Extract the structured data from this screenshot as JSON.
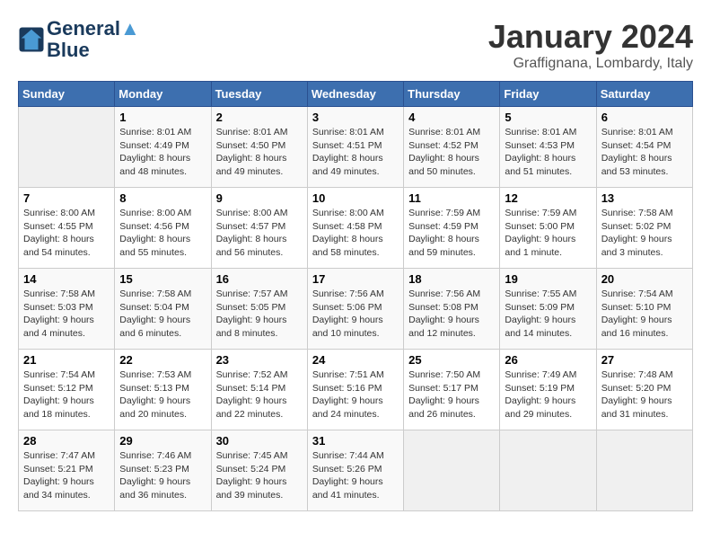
{
  "header": {
    "logo_line1": "General",
    "logo_line2": "Blue",
    "month": "January 2024",
    "location": "Graffignana, Lombardy, Italy"
  },
  "weekdays": [
    "Sunday",
    "Monday",
    "Tuesday",
    "Wednesday",
    "Thursday",
    "Friday",
    "Saturday"
  ],
  "weeks": [
    [
      {
        "day": "",
        "empty": true
      },
      {
        "day": "1",
        "sunrise": "8:01 AM",
        "sunset": "4:49 PM",
        "daylight": "8 hours and 48 minutes."
      },
      {
        "day": "2",
        "sunrise": "8:01 AM",
        "sunset": "4:50 PM",
        "daylight": "8 hours and 49 minutes."
      },
      {
        "day": "3",
        "sunrise": "8:01 AM",
        "sunset": "4:51 PM",
        "daylight": "8 hours and 49 minutes."
      },
      {
        "day": "4",
        "sunrise": "8:01 AM",
        "sunset": "4:52 PM",
        "daylight": "8 hours and 50 minutes."
      },
      {
        "day": "5",
        "sunrise": "8:01 AM",
        "sunset": "4:53 PM",
        "daylight": "8 hours and 51 minutes."
      },
      {
        "day": "6",
        "sunrise": "8:01 AM",
        "sunset": "4:54 PM",
        "daylight": "8 hours and 53 minutes."
      }
    ],
    [
      {
        "day": "7",
        "sunrise": "8:00 AM",
        "sunset": "4:55 PM",
        "daylight": "8 hours and 54 minutes."
      },
      {
        "day": "8",
        "sunrise": "8:00 AM",
        "sunset": "4:56 PM",
        "daylight": "8 hours and 55 minutes."
      },
      {
        "day": "9",
        "sunrise": "8:00 AM",
        "sunset": "4:57 PM",
        "daylight": "8 hours and 56 minutes."
      },
      {
        "day": "10",
        "sunrise": "8:00 AM",
        "sunset": "4:58 PM",
        "daylight": "8 hours and 58 minutes."
      },
      {
        "day": "11",
        "sunrise": "7:59 AM",
        "sunset": "4:59 PM",
        "daylight": "8 hours and 59 minutes."
      },
      {
        "day": "12",
        "sunrise": "7:59 AM",
        "sunset": "5:00 PM",
        "daylight": "9 hours and 1 minute."
      },
      {
        "day": "13",
        "sunrise": "7:58 AM",
        "sunset": "5:02 PM",
        "daylight": "9 hours and 3 minutes."
      }
    ],
    [
      {
        "day": "14",
        "sunrise": "7:58 AM",
        "sunset": "5:03 PM",
        "daylight": "9 hours and 4 minutes."
      },
      {
        "day": "15",
        "sunrise": "7:58 AM",
        "sunset": "5:04 PM",
        "daylight": "9 hours and 6 minutes."
      },
      {
        "day": "16",
        "sunrise": "7:57 AM",
        "sunset": "5:05 PM",
        "daylight": "9 hours and 8 minutes."
      },
      {
        "day": "17",
        "sunrise": "7:56 AM",
        "sunset": "5:06 PM",
        "daylight": "9 hours and 10 minutes."
      },
      {
        "day": "18",
        "sunrise": "7:56 AM",
        "sunset": "5:08 PM",
        "daylight": "9 hours and 12 minutes."
      },
      {
        "day": "19",
        "sunrise": "7:55 AM",
        "sunset": "5:09 PM",
        "daylight": "9 hours and 14 minutes."
      },
      {
        "day": "20",
        "sunrise": "7:54 AM",
        "sunset": "5:10 PM",
        "daylight": "9 hours and 16 minutes."
      }
    ],
    [
      {
        "day": "21",
        "sunrise": "7:54 AM",
        "sunset": "5:12 PM",
        "daylight": "9 hours and 18 minutes."
      },
      {
        "day": "22",
        "sunrise": "7:53 AM",
        "sunset": "5:13 PM",
        "daylight": "9 hours and 20 minutes."
      },
      {
        "day": "23",
        "sunrise": "7:52 AM",
        "sunset": "5:14 PM",
        "daylight": "9 hours and 22 minutes."
      },
      {
        "day": "24",
        "sunrise": "7:51 AM",
        "sunset": "5:16 PM",
        "daylight": "9 hours and 24 minutes."
      },
      {
        "day": "25",
        "sunrise": "7:50 AM",
        "sunset": "5:17 PM",
        "daylight": "9 hours and 26 minutes."
      },
      {
        "day": "26",
        "sunrise": "7:49 AM",
        "sunset": "5:19 PM",
        "daylight": "9 hours and 29 minutes."
      },
      {
        "day": "27",
        "sunrise": "7:48 AM",
        "sunset": "5:20 PM",
        "daylight": "9 hours and 31 minutes."
      }
    ],
    [
      {
        "day": "28",
        "sunrise": "7:47 AM",
        "sunset": "5:21 PM",
        "daylight": "9 hours and 34 minutes."
      },
      {
        "day": "29",
        "sunrise": "7:46 AM",
        "sunset": "5:23 PM",
        "daylight": "9 hours and 36 minutes."
      },
      {
        "day": "30",
        "sunrise": "7:45 AM",
        "sunset": "5:24 PM",
        "daylight": "9 hours and 39 minutes."
      },
      {
        "day": "31",
        "sunrise": "7:44 AM",
        "sunset": "5:26 PM",
        "daylight": "9 hours and 41 minutes."
      },
      {
        "day": "",
        "empty": true
      },
      {
        "day": "",
        "empty": true
      },
      {
        "day": "",
        "empty": true
      }
    ]
  ]
}
